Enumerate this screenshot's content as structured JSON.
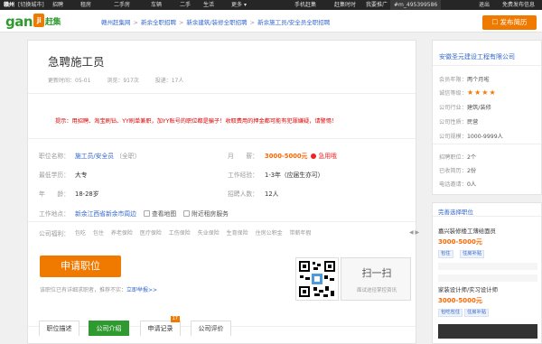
{
  "topbar": {
    "city": "赣州",
    "switch": "[切换城市]",
    "nav": [
      "招聘",
      "租房",
      "二手房",
      "车辆",
      "二手",
      "生活",
      "更多"
    ],
    "more_arrow": "▾",
    "mobile": "手机赶集",
    "timely": "赶集时时",
    "promo": "我要推广",
    "user": "#m_495399586",
    "logout": "退出",
    "free_publish": "免费发布信息"
  },
  "header": {
    "logo_text": "gan",
    "logo_ji": "ji",
    "logo_cn": "赶集",
    "breadcrumb": [
      "赣州赶集网",
      "新余全职招聘",
      "新余建筑/装修全职招聘",
      "新余施工员/安全员全职招聘"
    ],
    "publish_button": "发布简历"
  },
  "job": {
    "title": "急聘施工员",
    "updated": "更新时间：05-01",
    "views": "浏览：917次",
    "applicants": "投递：17人",
    "warning": "提示：用招聘、淘宝刷钻、YY刷单兼职，加YY账号的职位都是骗子！收取费用的押金都可能有犯罪嫌疑，请警惕！"
  },
  "fields": {
    "position_label": "职位名称：",
    "position_value": "施工员/安全员",
    "position_type": "（全职）",
    "salary_label": "月　　薪：",
    "salary_value": "3000-5000元",
    "hot": "急用哦",
    "education_label": "最低学历：",
    "education_value": "大专",
    "experience_label": "工作经验：",
    "experience_value": "1-3年（应届生亦可）",
    "age_label": "年　　龄：",
    "age_value": "18-28岁",
    "headcount_label": "招聘人数：",
    "headcount_value": "12人",
    "location_label": "工作地点：",
    "location_value": "新余江西省新余市周边",
    "view_map": "查看地图",
    "nearby": "附近租房服务",
    "welfare_label": "公司福利：",
    "welfare": [
      "包吃",
      "包住",
      "养老保险",
      "医疗保险",
      "工伤保险",
      "失业保险",
      "生育保险",
      "住房公积金",
      "带薪年假"
    ]
  },
  "apply": {
    "button": "申请职位",
    "note": "该职位已有详细求职者，推荐不实：",
    "complaint": "立即举报>>"
  },
  "qr": {
    "title": "扫一扫",
    "subtitle": "面试途径掌控资讯"
  },
  "tabs": [
    {
      "label": "职位描述"
    },
    {
      "label": "公司介绍"
    },
    {
      "label": "申请记录",
      "badge": "17"
    },
    {
      "label": "公司评价"
    }
  ],
  "company": {
    "name": "安徽圣元建设工程有限公司",
    "member_label": "会员年限：",
    "member_value": "两个月啦",
    "rating_label": "诚信等级：",
    "rating_stars": "★★★★",
    "industry_label": "公司行业：",
    "industry_value": "建筑/装修",
    "nature_label": "公司性质：",
    "nature_value": "民营",
    "size_label": "公司规模：",
    "size_value": "1000-9999人",
    "jobs_label": "招聘职位：",
    "jobs_value": "2个",
    "resumes_label": "已收简历：",
    "resumes_value": "2份",
    "reply_label": "电话邀请：",
    "reply_value": "0人"
  },
  "similar": {
    "header": "完善选择职位",
    "items": [
      {
        "title": "嘉兴装修楼工薄给面员",
        "salary": "3000-5000元",
        "tags": [
          "包住",
          "住房补贴"
        ]
      },
      {
        "title": "家装设计师/实习设计师",
        "salary": "3000-5000元",
        "tags": [
          "包吃包住",
          "住房补贴"
        ]
      }
    ]
  },
  "arrows": "◀ ▶"
}
